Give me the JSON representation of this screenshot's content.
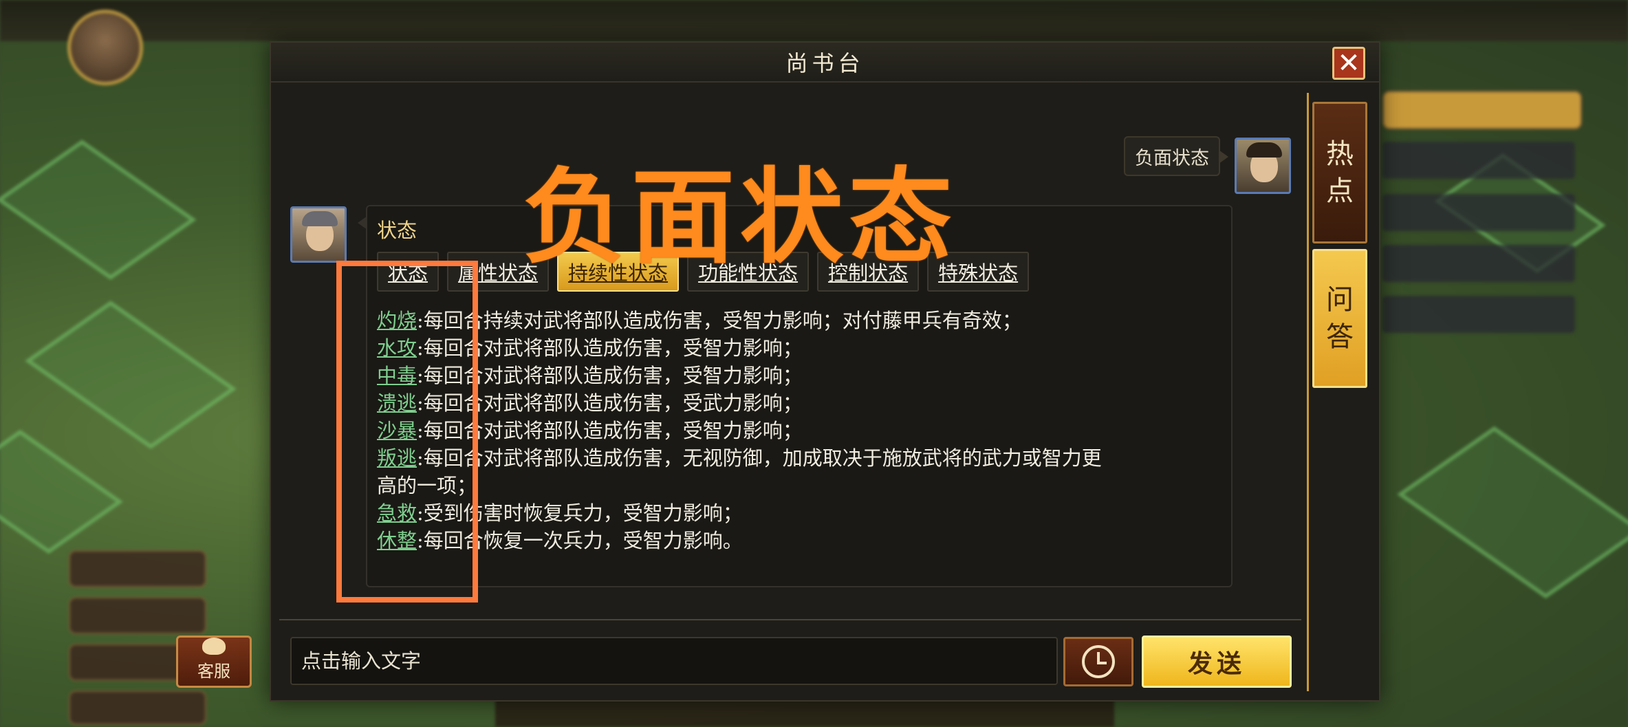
{
  "dialog": {
    "title": "尚书台",
    "close_label": "✕"
  },
  "overlay_title": "负面状态",
  "speaker_bubble": "负面状态",
  "panel": {
    "title": "状态",
    "tabs": [
      {
        "label": "状态",
        "active": false
      },
      {
        "label": "属性状态",
        "active": false
      },
      {
        "label": "持续性状态",
        "active": true
      },
      {
        "label": "功能性状态",
        "active": false
      },
      {
        "label": "控制状态",
        "active": false
      },
      {
        "label": "特殊状态",
        "active": false
      }
    ],
    "entries": [
      {
        "keyword": "灼烧",
        "text": ":每回合持续对武将部队造成伤害，受智力影响；对付藤甲兵有奇效；"
      },
      {
        "keyword": "水攻",
        "text": ":每回合对武将部队造成伤害，受智力影响；"
      },
      {
        "keyword": "中毒",
        "text": ":每回合对武将部队造成伤害，受智力影响；"
      },
      {
        "keyword": "溃逃",
        "text": ":每回合对武将部队造成伤害，受武力影响；"
      },
      {
        "keyword": "沙暴",
        "text": ":每回合对武将部队造成伤害，受智力影响；"
      },
      {
        "keyword": "叛逃",
        "text": ":每回合对武将部队造成伤害，无视防御，加成取决于施放武将的武力或智力更"
      },
      {
        "keyword": "",
        "text": "高的一项；"
      },
      {
        "keyword": "急救",
        "text": ":受到伤害时恢复兵力，受智力影响；"
      },
      {
        "keyword": "休整",
        "text": ":每回合恢复一次兵力，受智力影响。"
      }
    ]
  },
  "side_tabs": {
    "hot": [
      "热",
      "点"
    ],
    "qa": [
      "问",
      "答"
    ]
  },
  "input": {
    "placeholder": "点击输入文字",
    "send_label": "发送"
  },
  "customer_service_label": "客服",
  "icons": {
    "close": "close-icon",
    "history": "clock-icon",
    "customer_service": "advisor-icon"
  },
  "colors": {
    "accent_gold": "#f2c94c",
    "keyword_green": "#7fcf8f",
    "overlay_orange": "#ff8a1d",
    "highlight_box": "#ff7a3d"
  }
}
